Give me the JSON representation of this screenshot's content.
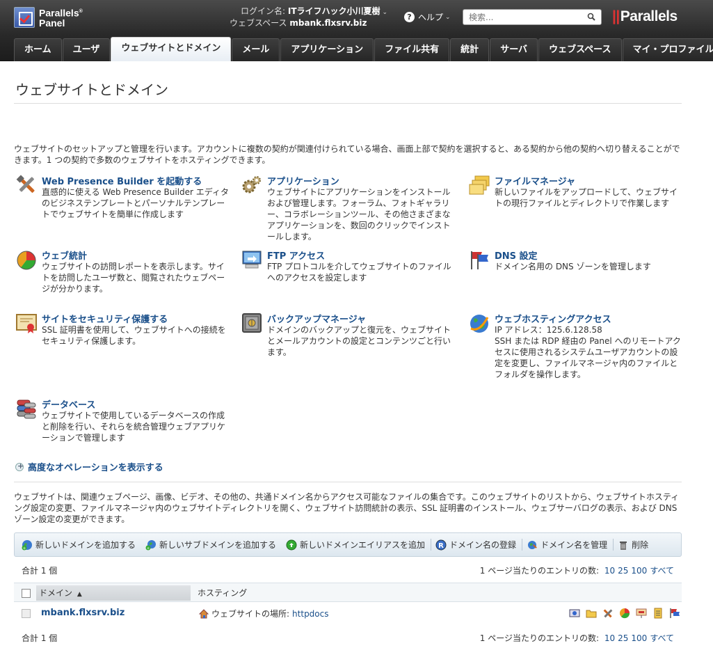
{
  "header": {
    "logo_line1": "Parallels",
    "logo_line2": "Panel",
    "login_label": "ログイン名: ",
    "login_user": "ITライフハック小川夏樹",
    "webspace_label": "ウェブスペース ",
    "webspace_value": "mbank.flxsrv.biz",
    "help_label": "ヘルプ",
    "search_placeholder": "検索...",
    "brand": "Parallels"
  },
  "tabs": [
    {
      "label": "ホーム"
    },
    {
      "label": "ユーザ"
    },
    {
      "label": "ウェブサイトとドメイン",
      "active": true
    },
    {
      "label": "メール"
    },
    {
      "label": "アプリケーション"
    },
    {
      "label": "ファイル共有"
    },
    {
      "label": "統計"
    },
    {
      "label": "サーバ"
    },
    {
      "label": "ウェブスペース"
    },
    {
      "label": "マイ・プロファイル"
    }
  ],
  "page": {
    "title": "ウェブサイトとドメイン",
    "intro": "ウェブサイトのセットアップと管理を行います。アカウントに複数の契約が関連付けられている場合、画面上部で契約を選択すると、ある契約から他の契約へ切り替えることができます。1 つの契約で多数のウェブサイトをホスティングできます。"
  },
  "tools": [
    {
      "title": "Web Presence Builder を起動する",
      "desc": "直感的に使える Web Presence Builder エディタのビジネステンプレートとパーソナルテンプレートでウェブサイトを簡単に作成します",
      "icon": "tools-icon"
    },
    {
      "title": "アプリケーション",
      "desc": "ウェブサイトにアプリケーションをインストールおよび管理します。フォーラム、フォトギャラリー、コラボレーションツール、その他さまざまなアプリケーションを、数回のクリックでインストールします。",
      "icon": "gears-icon"
    },
    {
      "title": "ファイルマネージャ",
      "desc": "新しいファイルをアップロードして、ウェブサイトの現行ファイルとディレクトリで作業します",
      "icon": "folders-icon"
    },
    {
      "title": "ウェブ統計",
      "desc": "ウェブサイトの訪問レポートを表示します。サイトを訪問したユーザ数と、閲覧されたウェブページが分かります。",
      "icon": "pie-chart-icon"
    },
    {
      "title": "FTP アクセス",
      "desc": "FTP プロトコルを介してウェブサイトのファイルへのアクセスを設定します",
      "icon": "ftp-icon"
    },
    {
      "title": "DNS 設定",
      "desc": "ドメイン名用の DNS ゾーンを管理します",
      "icon": "flags-icon"
    },
    {
      "title": "サイトをセキュリティ保護する",
      "desc": "SSL 証明書を使用して、ウェブサイトへの接続をセキュリティ保護します。",
      "icon": "certificate-icon"
    },
    {
      "title": "バックアップマネージャ",
      "desc": "ドメインのバックアップと復元を、ウェブサイトとメールアカウントの設定とコンテンツごと行います。",
      "icon": "safe-icon"
    },
    {
      "title": "ウェブホスティングアクセス",
      "ip": "IP アドレス：125.6.128.58",
      "desc": "SSH または RDP 経由の Panel へのリモートアクセスに使用されるシステムユーザアカウントの設定を変更し、ファイルマネージャ内のファイルとフォルダを操作します。",
      "icon": "globe-icon"
    },
    {
      "title": "データベース",
      "desc": "ウェブサイトで使用しているデータベースの作成と削除を行い、それらを統合管理ウェブアプリケーションで管理します",
      "icon": "database-icon"
    }
  ],
  "advanced_link": "高度なオペレーションを表示する",
  "websites_desc": "ウェブサイトは、関連ウェブページ、画像、ビデオ、その他の、共通ドメイン名からアクセス可能なファイルの集合です。このウェブサイトのリストから、ウェブサイトホスティング設定の変更、ファイルマネージャ内のウェブサイトディレクトリを開く、ウェブサイト訪問統計の表示、SSL 証明書のインストール、ウェブサーバログの表示、および DNS ゾーン設定の変更ができます。",
  "toolbar": {
    "add_domain": "新しいドメインを追加する",
    "add_subdomain": "新しいサブドメインを追加する",
    "add_alias": "新しいドメインエイリアスを追加",
    "register_domain": "ドメイン名の登録",
    "manage_domain": "ドメイン名を管理",
    "delete": "削除"
  },
  "list": {
    "total": "合計 1 個",
    "per_page_label": "1 ページ当たりのエントリの数: ",
    "per_page_options": [
      "10",
      "25",
      "100",
      "すべて"
    ],
    "col_domain": "ドメイン",
    "sort_arrow": "▲",
    "col_hosting": "ホスティング",
    "rows": [
      {
        "domain": "mbank.flxsrv.biz",
        "hosting_label": "ウェブサイトの場所: ",
        "hosting_value": "httpdocs"
      }
    ]
  }
}
